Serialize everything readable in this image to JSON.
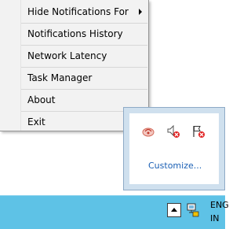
{
  "context_menu": {
    "items": [
      {
        "label": "Hide Notifications For",
        "has_submenu": true
      },
      {
        "label": "Notifications History"
      },
      {
        "label": "Network Latency"
      },
      {
        "label": "Task Manager"
      },
      {
        "label": "About"
      },
      {
        "label": "Exit"
      }
    ]
  },
  "tray_overflow": {
    "icons": [
      "notification-app-icon",
      "speaker-muted-icon",
      "action-center-flag-icon"
    ],
    "customize_label": "Customize..."
  },
  "taskbar": {
    "show_hidden_icon": "chevron-up-icon",
    "network_icon": "network-icon",
    "language_line1": "ENG",
    "language_line2": "IN"
  },
  "colors": {
    "menu_bg": "#f2f2f2",
    "taskbar_bg": "#5ec2e6",
    "overflow_border": "#cfe0ee",
    "link": "#1a5fb4",
    "error_badge": "#e02020"
  }
}
